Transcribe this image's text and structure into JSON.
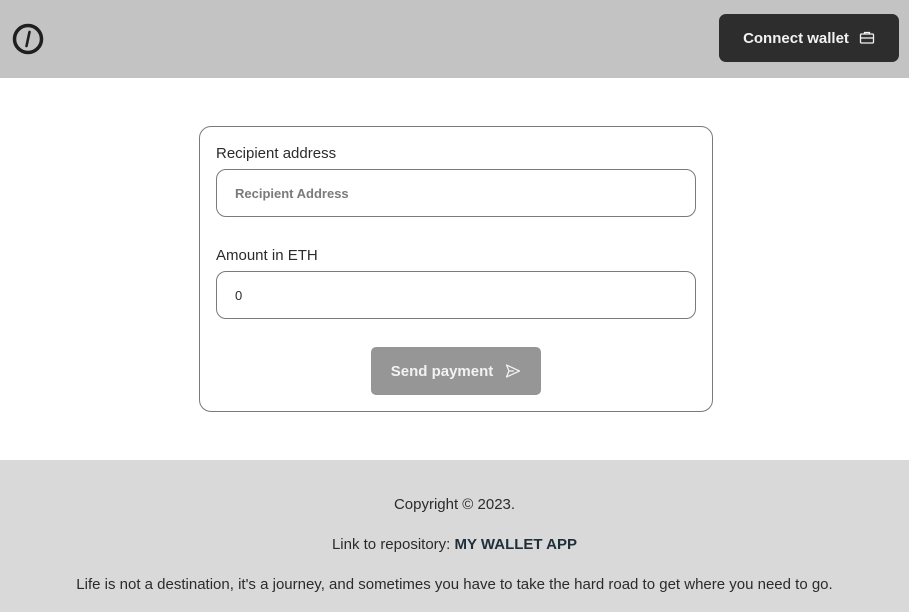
{
  "header": {
    "logo_icon": "logo-circle-icon",
    "connect_button": {
      "label": "Connect wallet",
      "icon": "wallet-icon"
    }
  },
  "form": {
    "recipient": {
      "label": "Recipient address",
      "placeholder": "Recipient Address",
      "value": ""
    },
    "amount": {
      "label": "Amount in ETH",
      "value": "0"
    },
    "send_button": {
      "label": "Send payment",
      "icon": "send-icon"
    }
  },
  "footer": {
    "copyright": "Copyright © 2023.",
    "repo_prefix": "Link to repository:",
    "repo_link_label": "MY WALLET APP",
    "quote": "Life is not a destination, it's a journey, and sometimes you have to take the hard road to get where you need to go."
  },
  "colors": {
    "header_bg": "#c3c3c3",
    "connect_button_bg": "#2d2d2d",
    "send_button_bg": "#969696",
    "footer_bg": "#d9d9d9"
  }
}
